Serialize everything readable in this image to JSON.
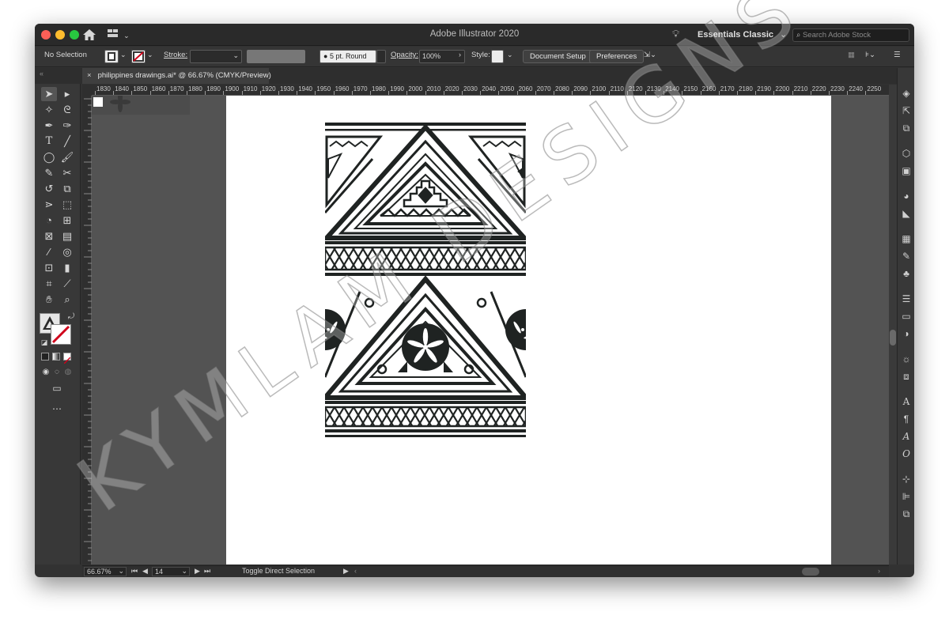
{
  "window": {
    "app_title": "Adobe Illustrator 2020",
    "workspace": "Essentials Classic",
    "search_placeholder": "Search Adobe Stock"
  },
  "control_bar": {
    "selection_status": "No Selection",
    "stroke_label": "Stroke:",
    "brush_label": "5 pt. Round",
    "opacity_label": "Opacity:",
    "opacity_value": "100%",
    "style_label": "Style:",
    "document_setup": "Document Setup",
    "preferences": "Preferences"
  },
  "document_tab": {
    "close": "×",
    "title": "philippines drawings.ai* @ 66.67% (CMYK/Preview)"
  },
  "ruler": {
    "top_ticks": [
      "1830",
      "1840",
      "1850",
      "1860",
      "1870",
      "1880",
      "1890",
      "1900",
      "1910",
      "1920",
      "1930",
      "1940",
      "1950",
      "1960",
      "1970",
      "1980",
      "1990",
      "2000",
      "2010",
      "2020",
      "2030",
      "2040",
      "2050",
      "2060",
      "2070",
      "2080",
      "2090",
      "2100",
      "2110",
      "2120",
      "2130",
      "2140",
      "2150",
      "2160",
      "2170",
      "2180",
      "2190",
      "2200",
      "2210",
      "2220",
      "2230",
      "2240",
      "2250"
    ]
  },
  "status_bar": {
    "zoom": "66.67%",
    "artboard_number": "14",
    "status_text": "Toggle Direct Selection"
  },
  "watermark": "KYMLAM DESIGNS",
  "colors": {
    "window_bg": "#323232",
    "panel_bg": "#383838",
    "canvas_bg": "#535353",
    "artwork": "#1f2322"
  },
  "icons": {
    "tools": [
      "selection-tool",
      "direct-selection-tool",
      "magic-wand-tool",
      "lasso-tool",
      "pen-tool",
      "curvature-tool",
      "type-tool",
      "line-segment-tool",
      "ellipse-tool",
      "paintbrush-tool",
      "pencil-tool",
      "scissors-tool",
      "rotate-tool",
      "scale-tool",
      "width-tool",
      "free-transform-tool",
      "shape-builder-tool",
      "perspective-grid-tool",
      "mesh-tool",
      "gradient-tool",
      "eyedropper-tool",
      "blend-tool",
      "symbol-sprayer-tool",
      "column-graph-tool",
      "artboard-tool",
      "slice-tool",
      "hand-tool",
      "zoom-tool"
    ],
    "panels": [
      "layers-icon",
      "export-icon",
      "artboards-icon",
      "libraries-icon",
      "properties-icon",
      "color-icon",
      "color-guide-icon",
      "swatches-icon",
      "brushes-icon",
      "symbols-icon",
      "stroke-icon",
      "gradient-icon",
      "transparency-icon",
      "appearance-icon",
      "graphic-styles-icon",
      "character-icon",
      "paragraph-icon",
      "opentype-icon",
      "glyphs-icon",
      "transform-icon",
      "align-icon",
      "pathfinder-icon"
    ]
  }
}
